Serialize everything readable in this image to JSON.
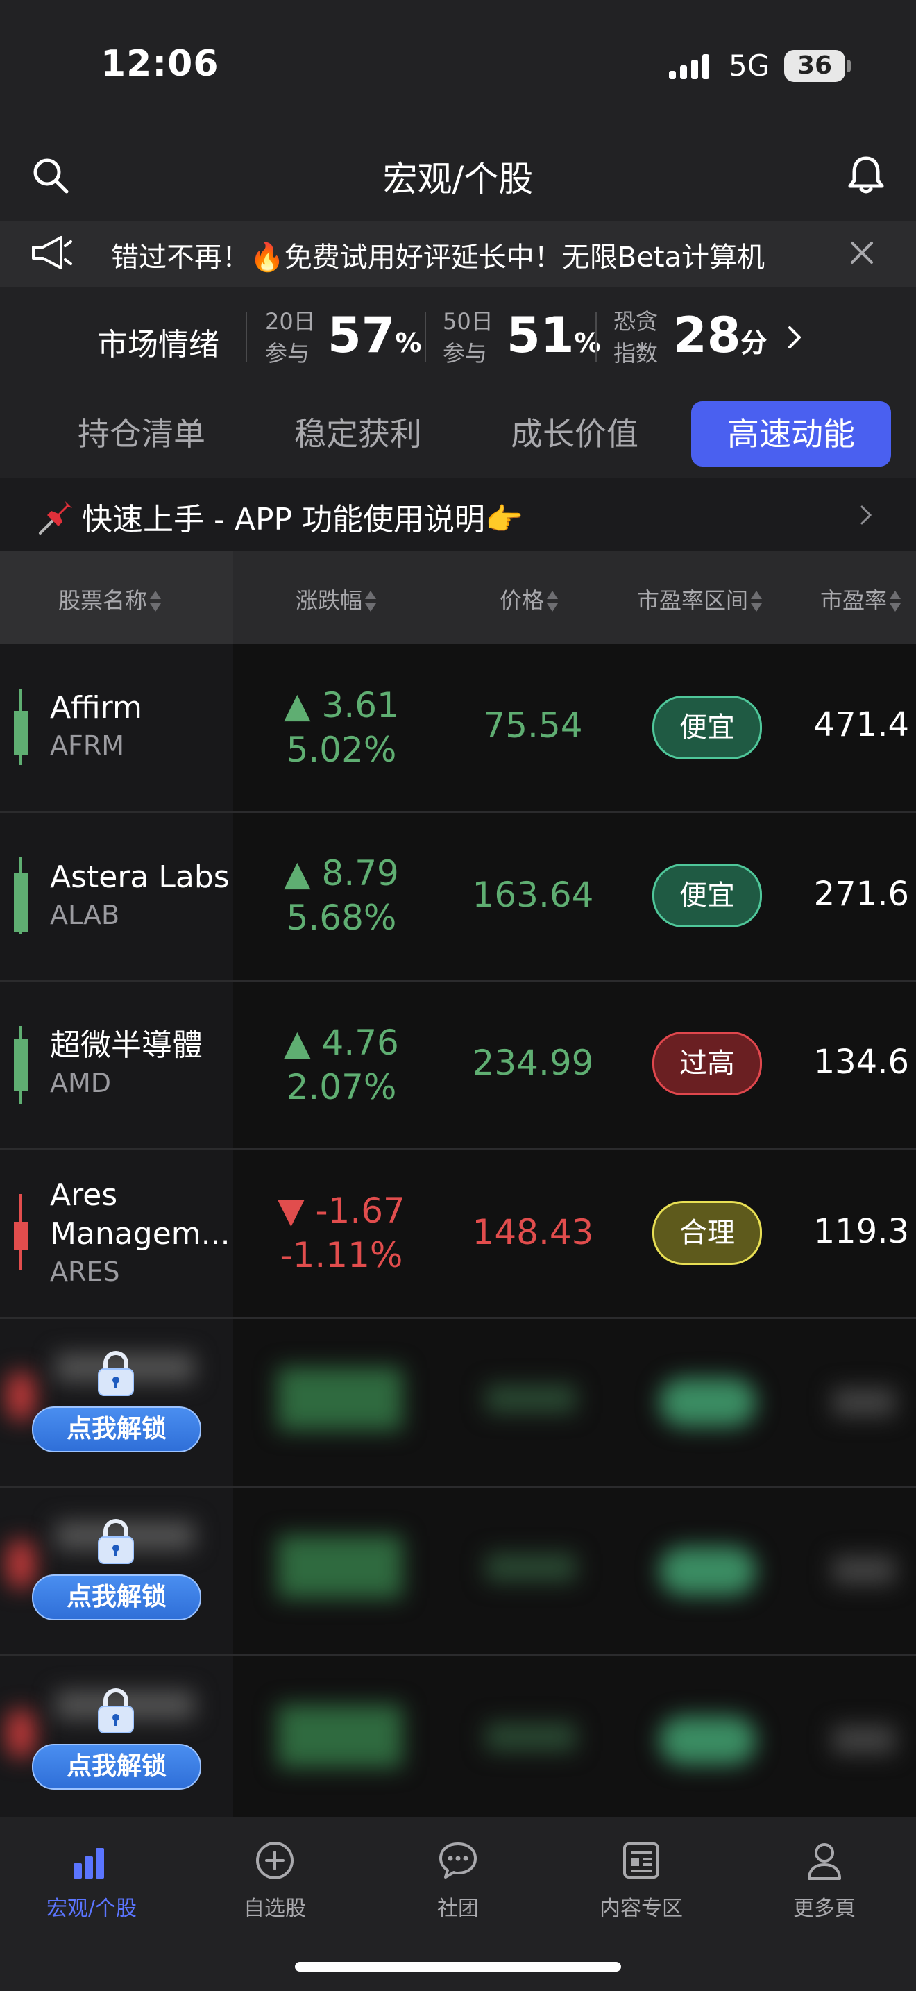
{
  "status_bar": {
    "time": "12:06",
    "network": "5G",
    "battery": "36"
  },
  "header": {
    "title": "宏观/个股"
  },
  "banner": {
    "text": "错过不再！🔥免费试用好评延长中！无限Beta计算机"
  },
  "sentiment": {
    "label": "市场情绪",
    "d20_label_1": "20日",
    "d20_label_2": "参与",
    "d20_value": "57",
    "d20_unit": "%",
    "d50_label_1": "50日",
    "d50_label_2": "参与",
    "d50_value": "51",
    "d50_unit": "%",
    "fg_label_1": "恐贪",
    "fg_label_2": "指数",
    "fg_value": "28",
    "fg_unit": "分"
  },
  "tabs": [
    {
      "label": "持仓清单",
      "active": false
    },
    {
      "label": "稳定获利",
      "active": false
    },
    {
      "label": "成长价值",
      "active": false
    },
    {
      "label": "高速动能",
      "active": true
    }
  ],
  "guide": {
    "text": "快速上手 - APP 功能使用说明👉"
  },
  "columns": [
    "股票名称",
    "涨跌幅",
    "价格",
    "市盈率区间",
    "市盈率"
  ],
  "rows": [
    {
      "name": "Affirm",
      "code": "AFRM",
      "change": "▲ 3.61",
      "change_pct": "5.02%",
      "price": "75.54",
      "pe_range": "便宜",
      "pe": "471.4",
      "direction": "up",
      "badge_color": "#1f5a43",
      "badge_border": "#4fc79a"
    },
    {
      "name": "Astera Labs",
      "code": "ALAB",
      "change": "▲ 8.79",
      "change_pct": "5.68%",
      "price": "163.64",
      "pe_range": "便宜",
      "pe": "271.6",
      "direction": "up",
      "badge_color": "#1f5a43",
      "badge_border": "#4fc79a"
    },
    {
      "name": "超微半導體",
      "code": "AMD",
      "change": "▲ 4.76",
      "change_pct": "2.07%",
      "price": "234.99",
      "pe_range": "过高",
      "pe": "134.6",
      "direction": "up",
      "badge_color": "#6a1f22",
      "badge_border": "#e0474d"
    },
    {
      "name": "Ares Managem...",
      "code": "ARES",
      "change": "▼ -1.67",
      "change_pct": "-1.11%",
      "price": "148.43",
      "pe_range": "合理",
      "pe": "119.3",
      "direction": "down",
      "badge_color": "#5e5a1c",
      "badge_border": "#e8df54"
    }
  ],
  "locked": {
    "unlock_label": "点我解锁"
  },
  "bottom_nav": [
    {
      "label": "宏观/个股",
      "icon": "bar-chart-icon",
      "active": true
    },
    {
      "label": "自选股",
      "icon": "plus-circle-icon",
      "active": false
    },
    {
      "label": "社团",
      "icon": "chat-bubble-icon",
      "active": false
    },
    {
      "label": "内容专区",
      "icon": "newspaper-icon",
      "active": false
    },
    {
      "label": "更多頁",
      "icon": "person-icon",
      "active": false
    }
  ]
}
